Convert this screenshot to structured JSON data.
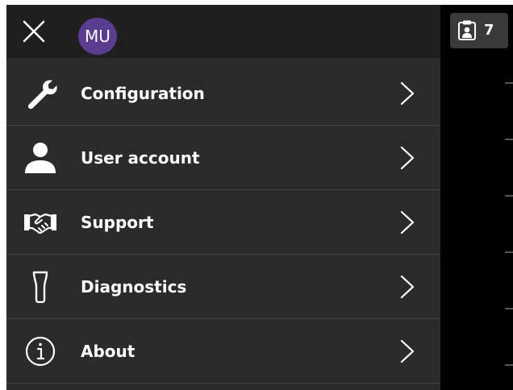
{
  "header": {
    "avatar_initials": "MU",
    "avatar_color": "#5a3d8f",
    "close_icon": "close-icon"
  },
  "menu": {
    "items": [
      {
        "label": "Configuration",
        "icon": "wrench-icon"
      },
      {
        "label": "User account",
        "icon": "user-icon"
      },
      {
        "label": "Support",
        "icon": "handshake-icon"
      },
      {
        "label": "Diagnostics",
        "icon": "probe-icon"
      },
      {
        "label": "About",
        "icon": "info-icon"
      }
    ]
  },
  "notifications": {
    "count": "7",
    "icon": "clipboard-user-icon"
  },
  "colors": {
    "drawer_bg": "#2b2b2b",
    "header_bg": "#1f1f1f",
    "screen_bg": "#000000",
    "text": "#ffffff"
  }
}
